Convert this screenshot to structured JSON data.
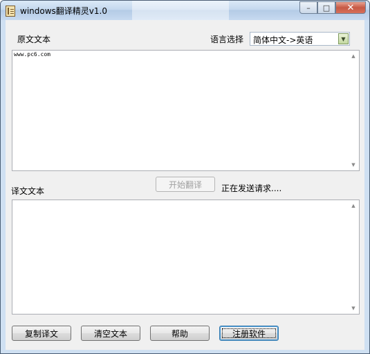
{
  "window": {
    "title": "windows翻译精灵v1.0"
  },
  "labels": {
    "source": "原文文本",
    "language": "语言选择",
    "target": "译文文本",
    "status": "正在发送请求...."
  },
  "language_select": {
    "selected": "简体中文->英语"
  },
  "source_text": {
    "value": "www.pc6.com"
  },
  "target_text": {
    "value": ""
  },
  "buttons": {
    "translate": "开始翻译",
    "copy": "复制译文",
    "clear": "清空文本",
    "help": "帮助",
    "register": "注册软件"
  },
  "icons": {
    "minimize": "minimize-icon",
    "maximize": "maximize-icon",
    "close": "close-icon"
  }
}
